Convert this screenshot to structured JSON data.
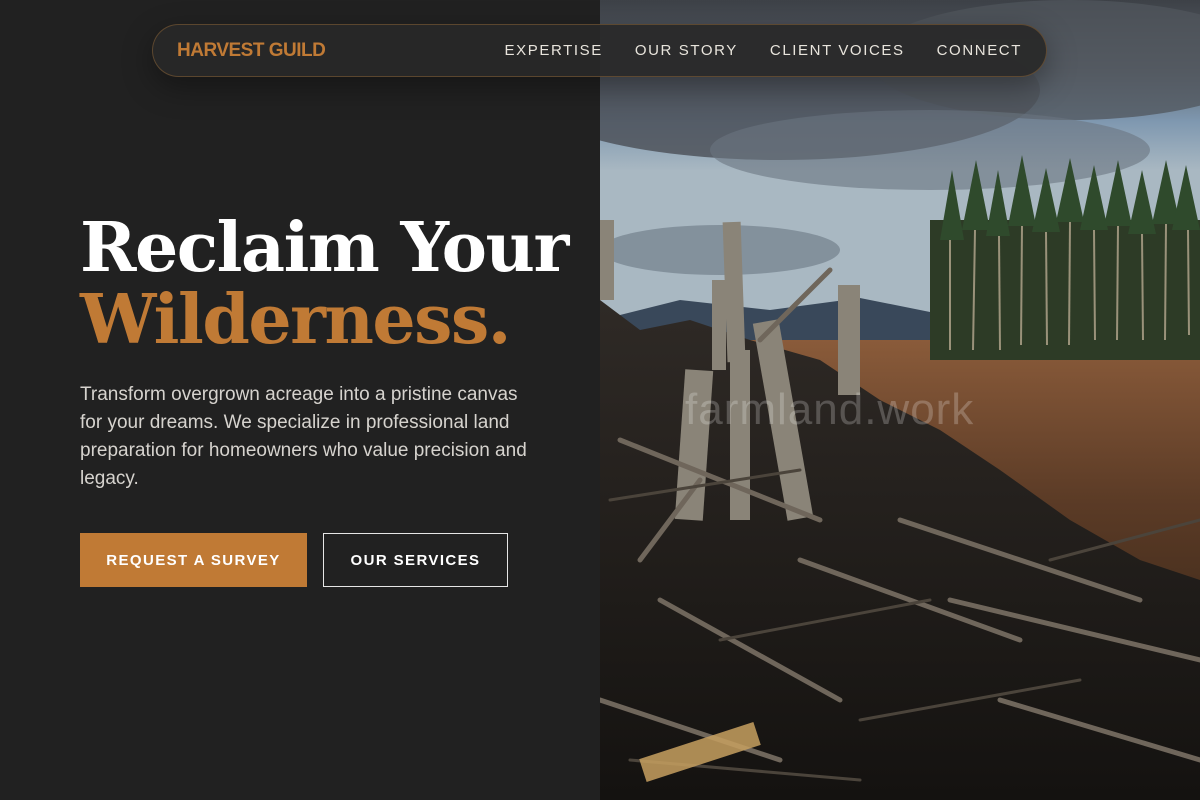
{
  "nav": {
    "brand": "HARVEST GUILD",
    "links": [
      "EXPERTISE",
      "OUR STORY",
      "CLIENT VOICES",
      "CONNECT"
    ]
  },
  "hero": {
    "title_line1": "Reclaim Your",
    "title_line2": "Wilderness.",
    "description": "Transform overgrown acreage into a pristine canvas for your dreams. We specialize in professional land preparation for homeowners who value precision and legacy.",
    "primary_cta": "REQUEST A SURVEY",
    "secondary_cta": "OUR SERVICES"
  },
  "image": {
    "watermark": "farmland.work"
  },
  "colors": {
    "background": "#212121",
    "accent": "#c07a35",
    "text_primary": "#ffffff",
    "text_secondary": "#d6d3ce"
  }
}
